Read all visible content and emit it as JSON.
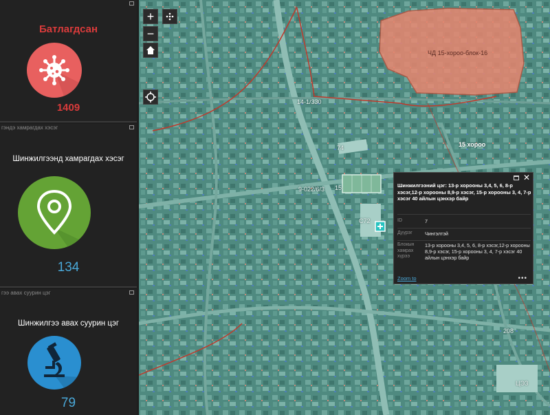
{
  "cards": [
    {
      "caption": "",
      "title": "Батлагдсан",
      "value": "1409",
      "icon": "virus-icon",
      "title_color": "#d93b3b",
      "value_color": "#d93b3b",
      "circle_color": "#e8605f"
    },
    {
      "caption": "гэндэ хамрагдах хэсэг",
      "title": "Шинжилгээнд хамрагдах хэсэг",
      "value": "134",
      "icon": "map-pin-icon",
      "title_color": "#ffffff",
      "value_color": "#4aa8d8",
      "circle_color": "#64a335"
    },
    {
      "caption": "гээ авах суурин цэг",
      "title": "Шинжилгээ авах суурин цэг",
      "value": "79",
      "icon": "microscope-icon",
      "title_color": "#ffffff",
      "value_color": "#4aa8d8",
      "circle_color": "#2a8fd0"
    }
  ],
  "map": {
    "controls": {
      "zoom_in": "+",
      "zoom_out": "−"
    },
    "labels": {
      "region": "ЧД 15-хороо-блок-16",
      "khoroo": "15 хороо",
      "l1": "14-1/330",
      "l2": "74",
      "l3": "9-022/6/3",
      "l4": "15",
      "l5": "С72",
      "l6": "208",
      "l7": "ЦЭЗ"
    },
    "highlight_color": "#e8866f"
  },
  "popup": {
    "title": "Шинжилгээний цэг: 13-р хорооны 3,4, 5, 6, 8-р хэсэг,12-р хорооны 8,9-р хэсэг, 15-р хорооны 3, 4, 7-р хэсэг 40 айлын цэнхэр байр",
    "fields": [
      {
        "key": "ID",
        "value": "7"
      },
      {
        "key": "Дүүрэг",
        "value": "Чингэлтэй"
      },
      {
        "key": "Блокын хамрах хүрээ",
        "value": "13-р хорооны 3,4, 5, 6, 8-р хэсэг,12-р хорооны 8,9-р хэсэг, 15-р хорооны 3, 4, 7-р хэсэг 40 айлын цэнхэр байр"
      }
    ],
    "zoom_to": "Zoom to",
    "more": "•••"
  }
}
